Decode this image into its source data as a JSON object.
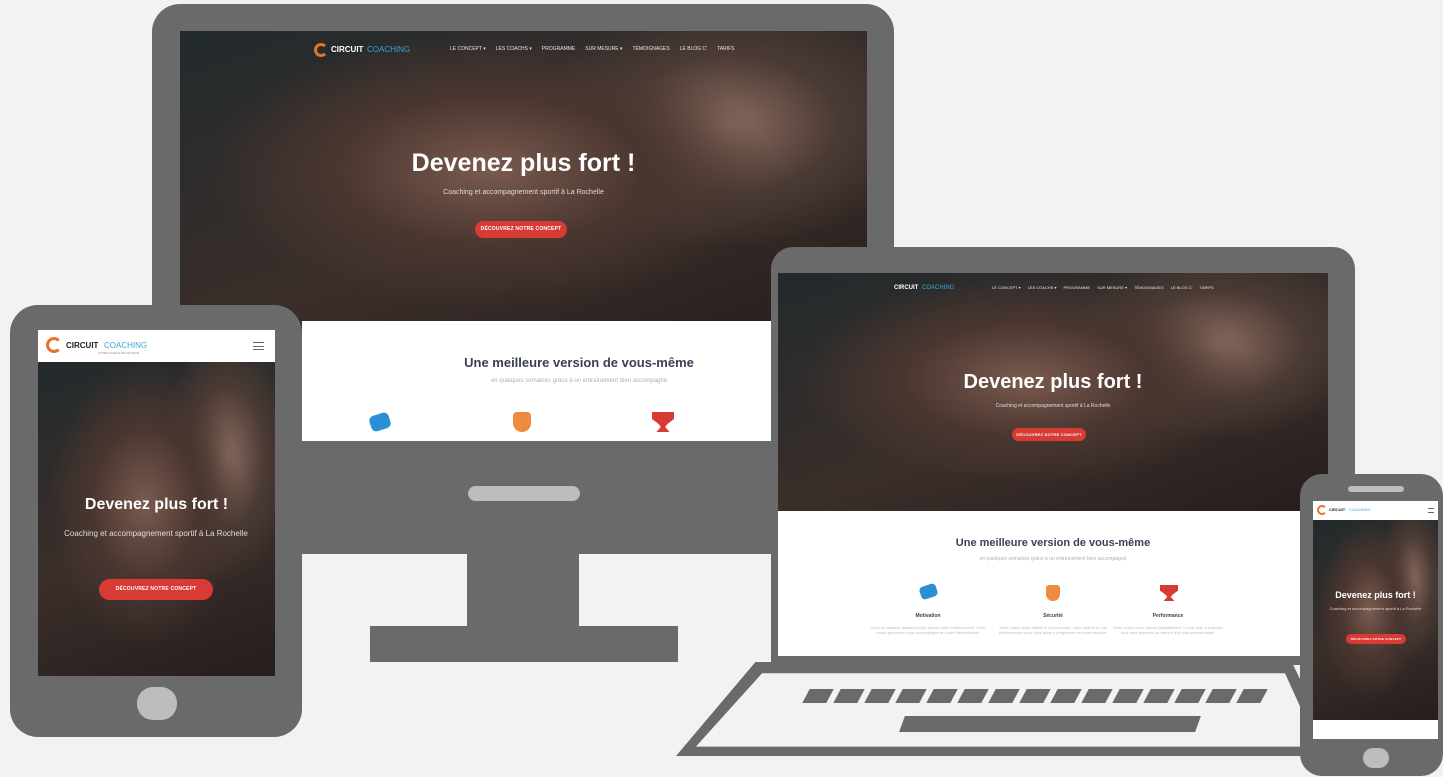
{
  "brand": {
    "name_part1": "CIRCUIT",
    "name_part2": "COACHING",
    "tagline": "VOTRE COACH ATLANTIQUE"
  },
  "nav": [
    "LE CONCEPT ▾",
    "LES COACHS ▾",
    "PROGRAMME",
    "SUR MESURE ▾",
    "TÉMOIGNAGES",
    "LE BLOG C'",
    "TARIFS"
  ],
  "hero": {
    "title": "Devenez plus fort !",
    "subtitle": "Coaching et accompagnement sportif à La Rochelle",
    "cta": "DÉCOUVREZ NOTRE CONCEPT"
  },
  "section": {
    "title": "Une meilleure version de vous-même",
    "subtitle": "en quelques semaines grâce à un entraînement bien accompagné"
  },
  "features": [
    {
      "icon": "handshake-icon",
      "color": "#2b8fd6",
      "title": "Motivation",
      "text": "Vous ne resterez jamais seul(e) durant votre entraînement. Votre coach personnel vous accompagne en toute bienveillance."
    },
    {
      "icon": "hand-eye-icon",
      "color": "#f08a3c",
      "title": "Sécurité",
      "text": "Votre coach reste attentif à vos postures, votre confort et vos performances pour vous aider à progresser en toute sécurité."
    },
    {
      "icon": "trophy-icon",
      "color": "#d83a34",
      "title": "Performance",
      "text": "Votre coach vous connait parfaitement. Il vous aide à exploiter tout votre potentiel au travers d'un plan personnalisé."
    }
  ],
  "menu_icon": "hamburger-icon"
}
